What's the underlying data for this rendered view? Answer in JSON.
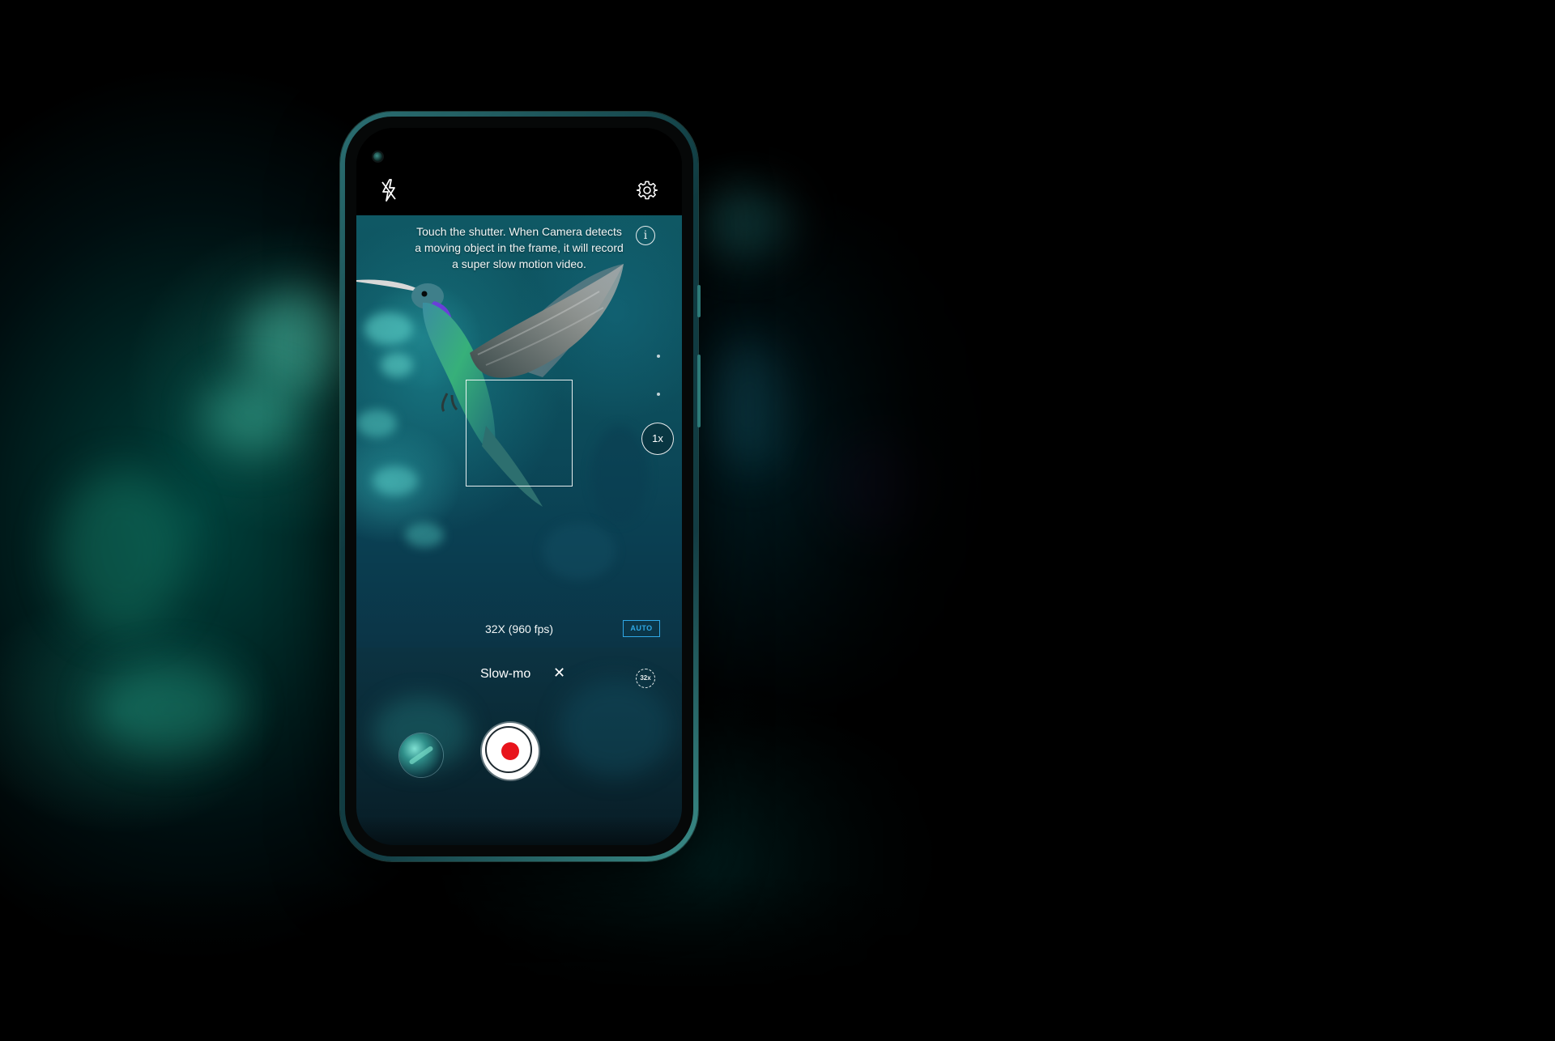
{
  "camera": {
    "hint_lines": [
      "Touch the shutter. When Camera detects",
      "a moving object in the frame, it will record",
      "a super slow motion video."
    ],
    "info_glyph": "i",
    "zoom_label": "1x",
    "fps_label": "32X (960 fps)",
    "auto_badge": "AUTO",
    "mode_label": "Slow-mo",
    "mode_close_glyph": "✕",
    "speed_label": "32x",
    "icons": {
      "flash": "flash-off-icon",
      "settings": "gear-icon",
      "info": "info-icon",
      "speed": "speed-32x-icon",
      "close": "close-icon"
    },
    "colors": {
      "record_dot": "#e8141c",
      "auto_badge": "#2fa8e6",
      "phone_frame": "#1b5358"
    }
  }
}
